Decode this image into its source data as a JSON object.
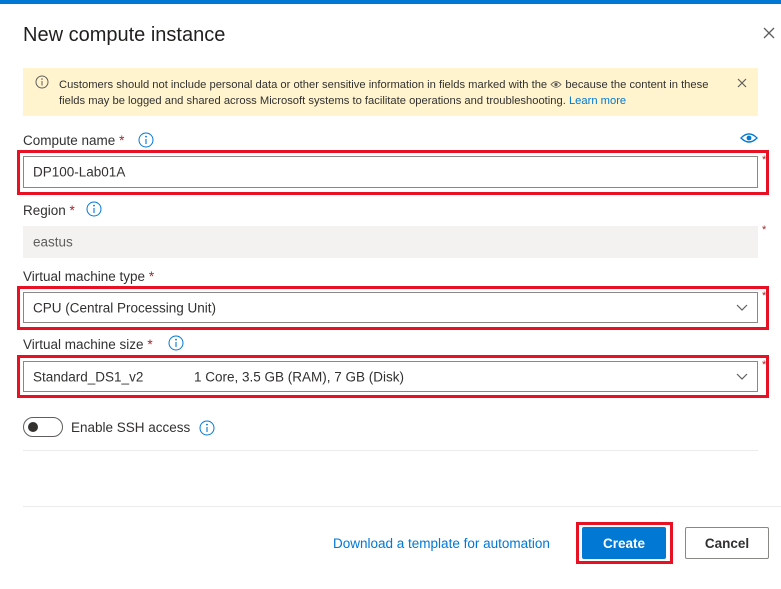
{
  "dialog": {
    "title": "New compute instance"
  },
  "banner": {
    "text_before": "Customers should not include personal data or other sensitive information in fields marked with the",
    "text_after": "because the content in these fields may be logged and shared across Microsoft systems to facilitate operations and troubleshooting.",
    "link": "Learn more"
  },
  "compute_name": {
    "label": "Compute name",
    "required_mark": "*",
    "value": "DP100-Lab01A"
  },
  "region": {
    "label": "Region",
    "required_mark": "*",
    "value": "eastus"
  },
  "vm_type": {
    "label": "Virtual machine type",
    "required_mark": "*",
    "value": "CPU (Central Processing Unit)"
  },
  "vm_size": {
    "label": "Virtual machine size",
    "required_mark": "*",
    "value_name": "Standard_DS1_v2",
    "value_detail": "1 Core, 3.5 GB (RAM), 7 GB (Disk)"
  },
  "ssh": {
    "label": "Enable SSH access",
    "enabled": false
  },
  "footer": {
    "download_link": "Download a template for automation",
    "create_label": "Create",
    "cancel_label": "Cancel"
  },
  "colors": {
    "accent": "#0078d4",
    "highlight_box": "#e81123",
    "banner_bg": "#fff4ce",
    "required": "#a4262c"
  },
  "icons": [
    "close-icon",
    "info-icon",
    "eye-icon",
    "chevron-down-icon"
  ]
}
